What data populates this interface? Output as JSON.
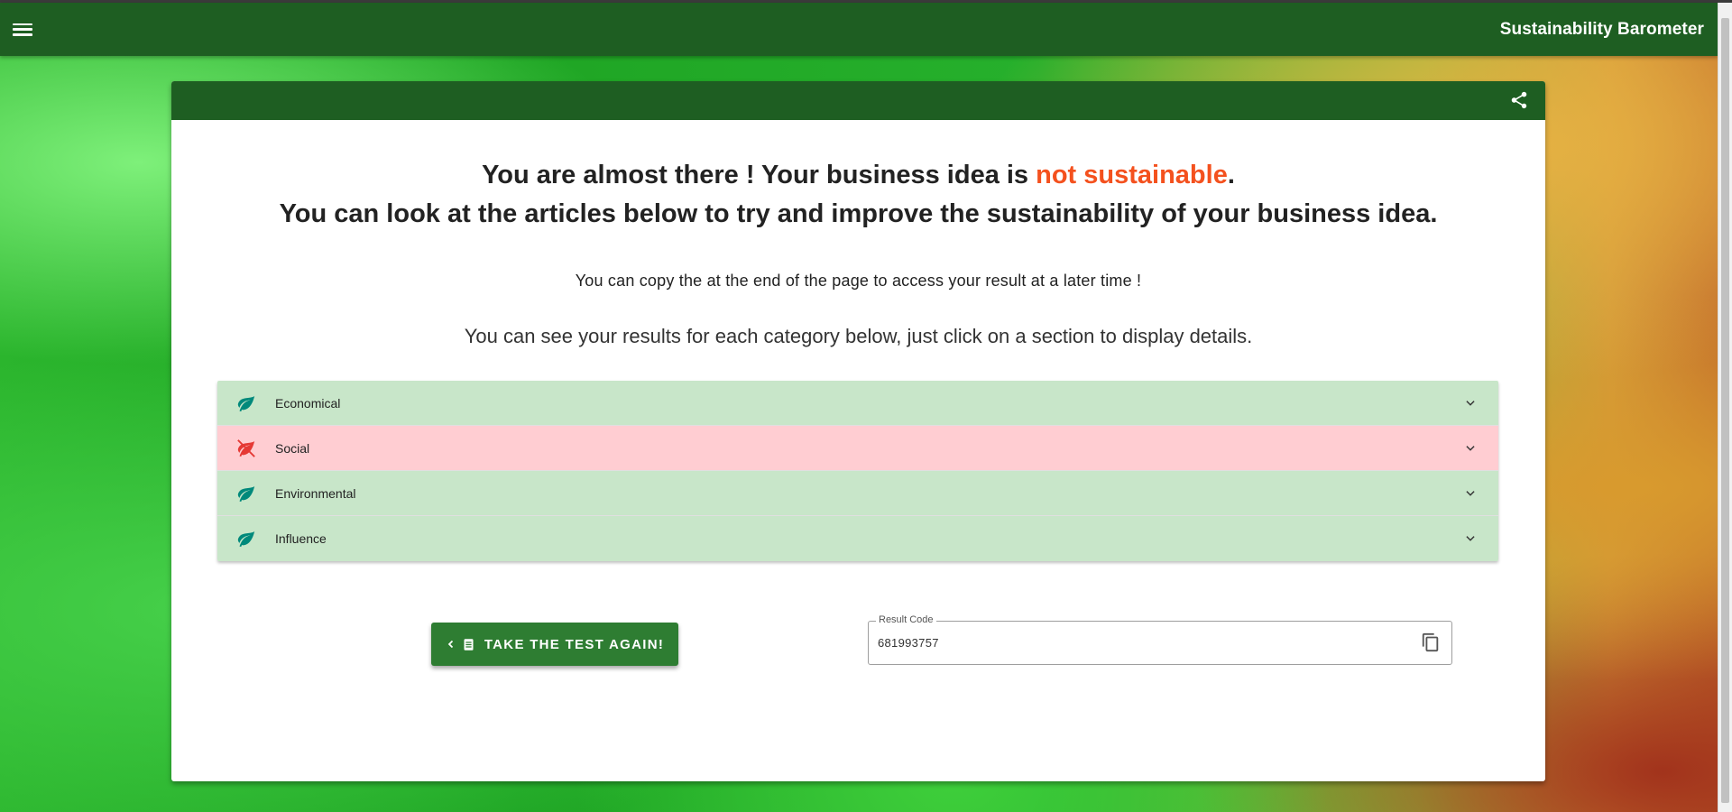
{
  "app": {
    "title": "Sustainability Barometer"
  },
  "headline": {
    "line1_prefix": "You are almost there ! Your business idea is ",
    "line1_status": "not sustainable",
    "line1_suffix": ".",
    "line2": "You can look at the articles below to try and improve the sustainability of your business idea."
  },
  "notes": {
    "copy_note": "You can copy the at the end of the page to access your result at a later time !",
    "results_note": "You can see your results for each category below, just click on a section to display details."
  },
  "categories": [
    {
      "label": "Economical",
      "status": "sustainable",
      "icon": "leaf-icon"
    },
    {
      "label": "Social",
      "status": "not-sustainable",
      "icon": "leaf-off-icon"
    },
    {
      "label": "Environmental",
      "status": "sustainable",
      "icon": "leaf-icon"
    },
    {
      "label": "Influence",
      "status": "sustainable",
      "icon": "leaf-icon"
    }
  ],
  "actions": {
    "retake_label": "TAKE THE TEST AGAIN!"
  },
  "result": {
    "legend": "Result Code",
    "code": "681993757"
  },
  "colors": {
    "primary": "#1e5e22",
    "button": "#2e7d32",
    "status_bad": "#f4511e",
    "row_good": "#c8e6c9",
    "row_bad": "#ffcdd2",
    "leaf_good": "#00897b",
    "leaf_bad": "#e53935"
  }
}
